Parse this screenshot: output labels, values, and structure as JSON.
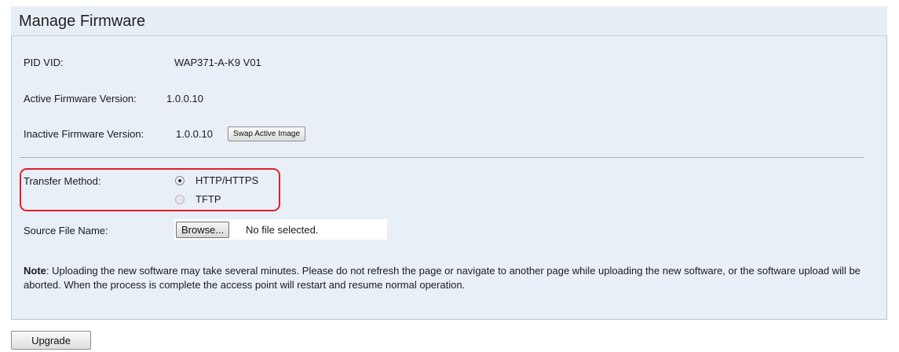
{
  "header": {
    "title": "Manage Firmware"
  },
  "info": {
    "pid_vid_label": "PID VID:",
    "pid_vid_value": "WAP371-A-K9 V01",
    "active_label": "Active Firmware Version:",
    "active_value": "1.0.0.10",
    "inactive_label": "Inactive Firmware Version:",
    "inactive_value": "1.0.0.10",
    "swap_button": "Swap Active Image"
  },
  "transfer": {
    "label": "Transfer Method:",
    "options": [
      {
        "label": "HTTP/HTTPS",
        "selected": true
      },
      {
        "label": "TFTP",
        "selected": false
      }
    ]
  },
  "source": {
    "label": "Source File Name:",
    "browse_button": "Browse...",
    "file_status": "No file selected."
  },
  "note": {
    "bold": "Note",
    "text": ": Uploading the new software may take several minutes. Please do not refresh the page or navigate to another page while uploading the new software, or the software upload will be aborted. When the process is complete the access point will restart and resume normal operation."
  },
  "actions": {
    "upgrade_button": "Upgrade"
  },
  "colors": {
    "panel_bg": "#e9eff6",
    "highlight": "#e0202a"
  }
}
